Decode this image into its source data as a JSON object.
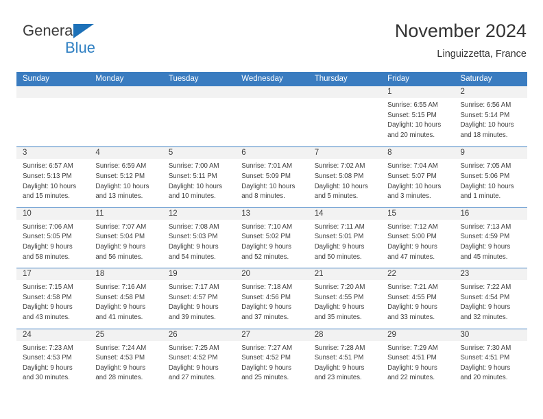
{
  "brand": {
    "name_top": "General",
    "name_bottom": "Blue",
    "accent_color": "#2e7fc2",
    "triangle_color": "#1d71b8"
  },
  "header": {
    "title": "November 2024",
    "subtitle": "Linguizzetta, France"
  },
  "calendar": {
    "header_color": "#3a7cc0",
    "date_strip_color": "#f2f2f2",
    "weekday_headers": [
      "Sunday",
      "Monday",
      "Tuesday",
      "Wednesday",
      "Thursday",
      "Friday",
      "Saturday"
    ],
    "weeks": [
      [
        {
          "day": "",
          "sunrise": "",
          "sunset": "",
          "daylight": "",
          "empty": true
        },
        {
          "day": "",
          "sunrise": "",
          "sunset": "",
          "daylight": "",
          "empty": true
        },
        {
          "day": "",
          "sunrise": "",
          "sunset": "",
          "daylight": "",
          "empty": true
        },
        {
          "day": "",
          "sunrise": "",
          "sunset": "",
          "daylight": "",
          "empty": true
        },
        {
          "day": "",
          "sunrise": "",
          "sunset": "",
          "daylight": "",
          "empty": true
        },
        {
          "day": "1",
          "sunrise": "Sunrise: 6:55 AM",
          "sunset": "Sunset: 5:15 PM",
          "daylight": "Daylight: 10 hours and 20 minutes."
        },
        {
          "day": "2",
          "sunrise": "Sunrise: 6:56 AM",
          "sunset": "Sunset: 5:14 PM",
          "daylight": "Daylight: 10 hours and 18 minutes."
        }
      ],
      [
        {
          "day": "3",
          "sunrise": "Sunrise: 6:57 AM",
          "sunset": "Sunset: 5:13 PM",
          "daylight": "Daylight: 10 hours and 15 minutes."
        },
        {
          "day": "4",
          "sunrise": "Sunrise: 6:59 AM",
          "sunset": "Sunset: 5:12 PM",
          "daylight": "Daylight: 10 hours and 13 minutes."
        },
        {
          "day": "5",
          "sunrise": "Sunrise: 7:00 AM",
          "sunset": "Sunset: 5:11 PM",
          "daylight": "Daylight: 10 hours and 10 minutes."
        },
        {
          "day": "6",
          "sunrise": "Sunrise: 7:01 AM",
          "sunset": "Sunset: 5:09 PM",
          "daylight": "Daylight: 10 hours and 8 minutes."
        },
        {
          "day": "7",
          "sunrise": "Sunrise: 7:02 AM",
          "sunset": "Sunset: 5:08 PM",
          "daylight": "Daylight: 10 hours and 5 minutes."
        },
        {
          "day": "8",
          "sunrise": "Sunrise: 7:04 AM",
          "sunset": "Sunset: 5:07 PM",
          "daylight": "Daylight: 10 hours and 3 minutes."
        },
        {
          "day": "9",
          "sunrise": "Sunrise: 7:05 AM",
          "sunset": "Sunset: 5:06 PM",
          "daylight": "Daylight: 10 hours and 1 minute."
        }
      ],
      [
        {
          "day": "10",
          "sunrise": "Sunrise: 7:06 AM",
          "sunset": "Sunset: 5:05 PM",
          "daylight": "Daylight: 9 hours and 58 minutes."
        },
        {
          "day": "11",
          "sunrise": "Sunrise: 7:07 AM",
          "sunset": "Sunset: 5:04 PM",
          "daylight": "Daylight: 9 hours and 56 minutes."
        },
        {
          "day": "12",
          "sunrise": "Sunrise: 7:08 AM",
          "sunset": "Sunset: 5:03 PM",
          "daylight": "Daylight: 9 hours and 54 minutes."
        },
        {
          "day": "13",
          "sunrise": "Sunrise: 7:10 AM",
          "sunset": "Sunset: 5:02 PM",
          "daylight": "Daylight: 9 hours and 52 minutes."
        },
        {
          "day": "14",
          "sunrise": "Sunrise: 7:11 AM",
          "sunset": "Sunset: 5:01 PM",
          "daylight": "Daylight: 9 hours and 50 minutes."
        },
        {
          "day": "15",
          "sunrise": "Sunrise: 7:12 AM",
          "sunset": "Sunset: 5:00 PM",
          "daylight": "Daylight: 9 hours and 47 minutes."
        },
        {
          "day": "16",
          "sunrise": "Sunrise: 7:13 AM",
          "sunset": "Sunset: 4:59 PM",
          "daylight": "Daylight: 9 hours and 45 minutes."
        }
      ],
      [
        {
          "day": "17",
          "sunrise": "Sunrise: 7:15 AM",
          "sunset": "Sunset: 4:58 PM",
          "daylight": "Daylight: 9 hours and 43 minutes."
        },
        {
          "day": "18",
          "sunrise": "Sunrise: 7:16 AM",
          "sunset": "Sunset: 4:58 PM",
          "daylight": "Daylight: 9 hours and 41 minutes."
        },
        {
          "day": "19",
          "sunrise": "Sunrise: 7:17 AM",
          "sunset": "Sunset: 4:57 PM",
          "daylight": "Daylight: 9 hours and 39 minutes."
        },
        {
          "day": "20",
          "sunrise": "Sunrise: 7:18 AM",
          "sunset": "Sunset: 4:56 PM",
          "daylight": "Daylight: 9 hours and 37 minutes."
        },
        {
          "day": "21",
          "sunrise": "Sunrise: 7:20 AM",
          "sunset": "Sunset: 4:55 PM",
          "daylight": "Daylight: 9 hours and 35 minutes."
        },
        {
          "day": "22",
          "sunrise": "Sunrise: 7:21 AM",
          "sunset": "Sunset: 4:55 PM",
          "daylight": "Daylight: 9 hours and 33 minutes."
        },
        {
          "day": "23",
          "sunrise": "Sunrise: 7:22 AM",
          "sunset": "Sunset: 4:54 PM",
          "daylight": "Daylight: 9 hours and 32 minutes."
        }
      ],
      [
        {
          "day": "24",
          "sunrise": "Sunrise: 7:23 AM",
          "sunset": "Sunset: 4:53 PM",
          "daylight": "Daylight: 9 hours and 30 minutes."
        },
        {
          "day": "25",
          "sunrise": "Sunrise: 7:24 AM",
          "sunset": "Sunset: 4:53 PM",
          "daylight": "Daylight: 9 hours and 28 minutes."
        },
        {
          "day": "26",
          "sunrise": "Sunrise: 7:25 AM",
          "sunset": "Sunset: 4:52 PM",
          "daylight": "Daylight: 9 hours and 27 minutes."
        },
        {
          "day": "27",
          "sunrise": "Sunrise: 7:27 AM",
          "sunset": "Sunset: 4:52 PM",
          "daylight": "Daylight: 9 hours and 25 minutes."
        },
        {
          "day": "28",
          "sunrise": "Sunrise: 7:28 AM",
          "sunset": "Sunset: 4:51 PM",
          "daylight": "Daylight: 9 hours and 23 minutes."
        },
        {
          "day": "29",
          "sunrise": "Sunrise: 7:29 AM",
          "sunset": "Sunset: 4:51 PM",
          "daylight": "Daylight: 9 hours and 22 minutes."
        },
        {
          "day": "30",
          "sunrise": "Sunrise: 7:30 AM",
          "sunset": "Sunset: 4:51 PM",
          "daylight": "Daylight: 9 hours and 20 minutes."
        }
      ]
    ]
  }
}
